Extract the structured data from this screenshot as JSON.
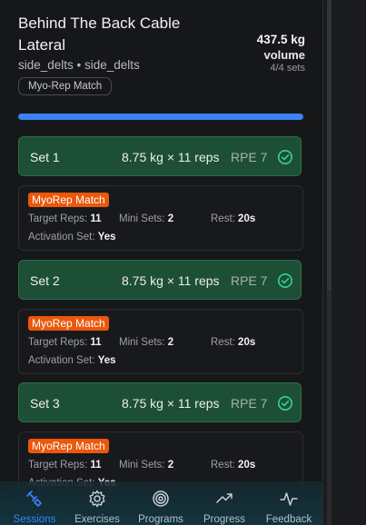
{
  "exercise": {
    "title": "Behind The Back Cable Lateral",
    "muscles": "side_delts • side_delts",
    "tag": "Myo-Rep Match",
    "volume_value": "437.5 kg",
    "volume_label": "volume",
    "sets_done": "4/4 sets"
  },
  "progress": {
    "fraction": 1.0,
    "color": "#3b82f6"
  },
  "sets": [
    {
      "label": "Set 1",
      "detail": "8.75 kg × 11 reps",
      "rpe": "RPE 7",
      "badge": "MyoRep Match",
      "target_label": "Target Reps:",
      "target_value": "11",
      "mini_label": "Mini Sets:",
      "mini_value": "2",
      "rest_label": "Rest:",
      "rest_value": "20s",
      "activation_label": "Activation Set:",
      "activation_value": "Yes"
    },
    {
      "label": "Set 2",
      "detail": "8.75 kg × 11 reps",
      "rpe": "RPE 7",
      "badge": "MyoRep Match",
      "target_label": "Target Reps:",
      "target_value": "11",
      "mini_label": "Mini Sets:",
      "mini_value": "2",
      "rest_label": "Rest:",
      "rest_value": "20s",
      "activation_label": "Activation Set:",
      "activation_value": "Yes"
    },
    {
      "label": "Set 3",
      "detail": "8.75 kg × 11 reps",
      "rpe": "RPE 7",
      "badge": "MyoRep Match",
      "target_label": "Target Reps:",
      "target_value": "11",
      "mini_label": "Mini Sets:",
      "mini_value": "2",
      "rest_label": "Rest:",
      "rest_value": "20s",
      "activation_label": "Activation Set:",
      "activation_value": "Yes"
    }
  ],
  "nav": [
    {
      "label": "Sessions",
      "icon": "sessions-icon",
      "active": true
    },
    {
      "label": "Exercises",
      "icon": "gear-icon",
      "active": false
    },
    {
      "label": "Programs",
      "icon": "target-icon",
      "active": false
    },
    {
      "label": "Progress",
      "icon": "trending-up-icon",
      "active": false
    },
    {
      "label": "Feedback",
      "icon": "pulse-icon",
      "active": false
    }
  ],
  "colors": {
    "completed_set_bg": "#1d4f36",
    "badge": "#ea580c",
    "check": "#34d399",
    "accent": "#3b82f6"
  }
}
